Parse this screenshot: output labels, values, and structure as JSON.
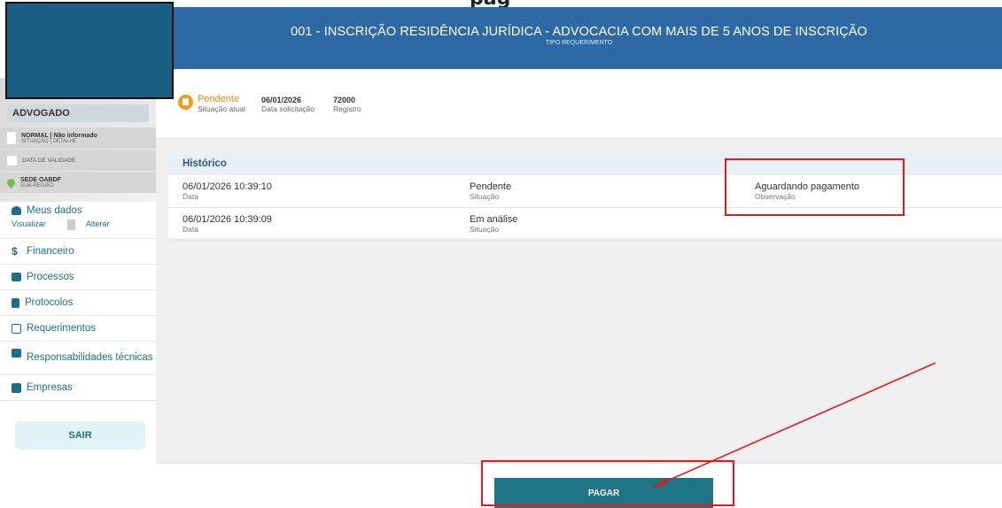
{
  "header": {
    "title": "001 - INSCRIÇÃO RESIDÊNCIA JURÍDICA - ADVOCACIA COM MAIS DE 5 ANOS DE INSCRIÇÃO",
    "subtitle": "TIPO REQUERIMENTO",
    "background": "#2d69a5"
  },
  "cropped_top_text": "pag",
  "profile": {
    "role": "ADVOGADO",
    "status_value": "NORMAL | Não informado",
    "status_label": "SITUAÇÃO | DETALHE",
    "validity_label": "DATA DE VALIDADE",
    "office_value": "SEDE OABDF",
    "office_label": "SUB-REGIÃO"
  },
  "sidebar": {
    "meus_dados": {
      "label": "Meus dados",
      "view": "Visualizar",
      "edit": "Alterar"
    },
    "items": [
      {
        "label": "Financeiro",
        "icon": "dollar-icon"
      },
      {
        "label": "Processos",
        "icon": "folder-icon"
      },
      {
        "label": "Protocolos",
        "icon": "document-icon"
      },
      {
        "label": "Requerimentos",
        "icon": "form-icon"
      },
      {
        "label": "Responsabilidades técnicas",
        "icon": "hand-icon"
      },
      {
        "label": "Empresas",
        "icon": "building-icon"
      }
    ],
    "logout": "SAIR"
  },
  "status": {
    "current": {
      "value": "Pendente",
      "label": "Situação atual",
      "color": "#f49a1c"
    },
    "date": {
      "value": "06/01/2026",
      "label": "Data solicitação"
    },
    "record": {
      "value": "72000",
      "label": "Registro"
    }
  },
  "history": {
    "title": "Histórico",
    "rows": [
      {
        "date": "06/01/2026 10:39:10",
        "date_label": "Data",
        "status": "Pendente",
        "status_label": "Situação",
        "note": "Aguardando pagamento",
        "note_label": "Observação"
      },
      {
        "date": "06/01/2026 10:39:09",
        "date_label": "Data",
        "status": "Em análise",
        "status_label": "Situação"
      }
    ]
  },
  "actions": {
    "pay": "PAGAR",
    "pay_color": "#1f7585"
  },
  "annotation_color": "#e51b1b"
}
